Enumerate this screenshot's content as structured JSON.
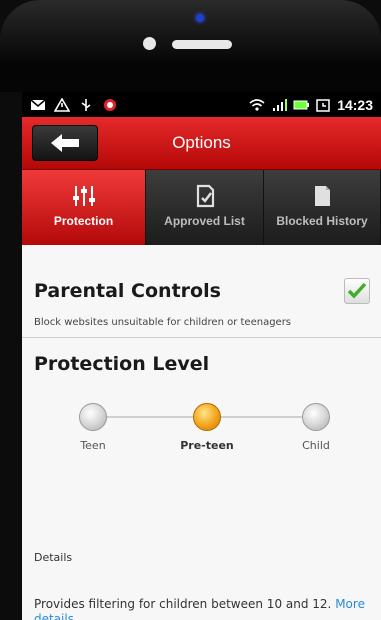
{
  "status_bar": {
    "time": "14:23",
    "icons": [
      "mail-icon",
      "warning-icon",
      "usb-icon",
      "alert-icon",
      "wifi-icon",
      "signal-icon",
      "battery-icon",
      "alarm-icon"
    ]
  },
  "header": {
    "title": "Options",
    "back_icon": "back-arrow-icon"
  },
  "tabs": [
    {
      "label": "Protection",
      "icon": "sliders-icon",
      "active": true
    },
    {
      "label": "Approved List",
      "icon": "approved-doc-icon",
      "active": false
    },
    {
      "label": "Blocked History",
      "icon": "blocked-doc-icon",
      "active": false
    }
  ],
  "parental_controls": {
    "title": "Parental Controls",
    "description": "Block websites unsuitable for children or teenagers",
    "checked": true
  },
  "protection_level": {
    "title": "Protection Level",
    "options": [
      {
        "label": "Teen",
        "selected": false
      },
      {
        "label": "Pre-teen",
        "selected": true
      },
      {
        "label": "Child",
        "selected": false
      }
    ]
  },
  "details": {
    "label": "Details",
    "text": "Provides filtering for children between 10 and 12.",
    "more_link": "More details"
  },
  "colors": {
    "brand_red": "#d11a1a",
    "selected_radio": "#f2a31a",
    "link": "#2a8bd8",
    "check_green": "#3fae2a"
  }
}
